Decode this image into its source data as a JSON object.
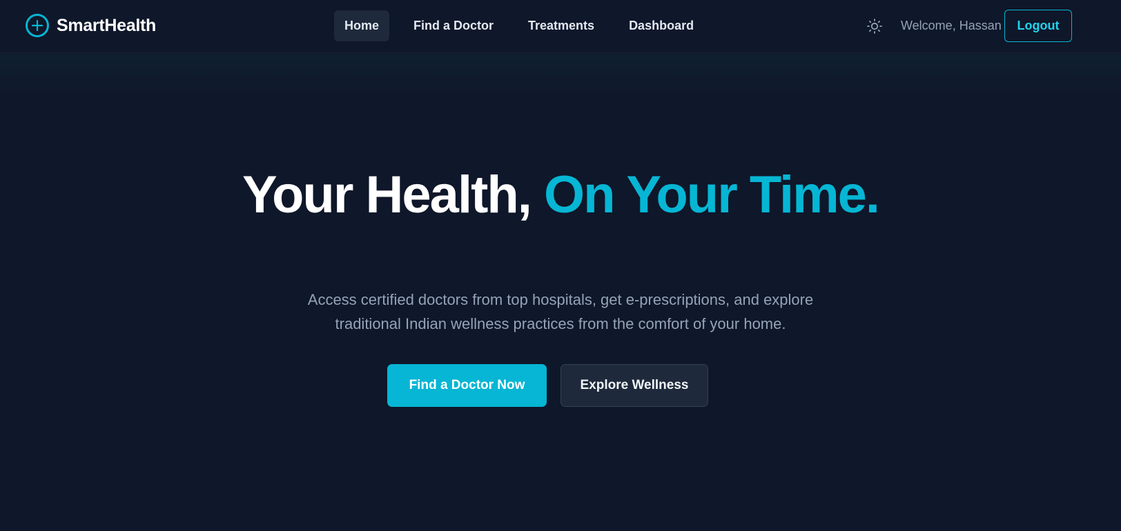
{
  "brand": {
    "name": "SmartHealth",
    "icon": "plus-circle-icon"
  },
  "nav": {
    "items": [
      {
        "label": "Home",
        "active": true
      },
      {
        "label": "Find a Doctor",
        "active": false
      },
      {
        "label": "Treatments",
        "active": false
      },
      {
        "label": "Dashboard",
        "active": false
      }
    ]
  },
  "header": {
    "theme_icon": "sun-icon",
    "welcome": "Welcome, Hassan",
    "logout_label": "Logout"
  },
  "hero": {
    "headline_main": "Your Health,",
    "headline_accent": "On Your Time.",
    "subtitle_line1": "Access certified doctors from top hospitals, get e-prescriptions, and explore",
    "subtitle_line2": "traditional Indian wellness practices from the comfort of your home.",
    "primary_cta": "Find a Doctor Now",
    "secondary_cta": "Explore Wellness"
  },
  "colors": {
    "background": "#0f172a",
    "accent": "#06b6d4",
    "muted_text": "#94a3b8",
    "surface": "#1e293b"
  }
}
